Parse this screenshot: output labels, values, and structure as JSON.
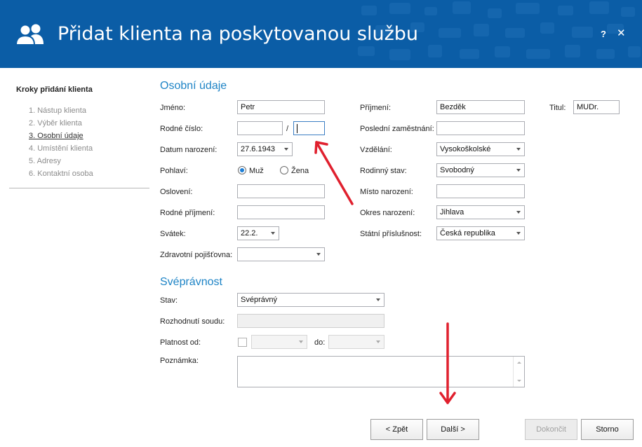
{
  "header": {
    "title": "Přidat klienta na poskytovanou službu",
    "help_label": "?",
    "close_label": "✕",
    "icon": "users-icon",
    "background_color": "#0b5da6"
  },
  "sidebar": {
    "title": "Kroky přidání klienta",
    "steps": [
      {
        "label": "1. Nástup klienta",
        "active": false
      },
      {
        "label": "2. Výběr klienta",
        "active": false
      },
      {
        "label": "3. Osobní údaje",
        "active": true
      },
      {
        "label": "4. Umístění klienta",
        "active": false
      },
      {
        "label": "5. Adresy",
        "active": false
      },
      {
        "label": "6. Kontaktní osoba",
        "active": false
      }
    ]
  },
  "personal": {
    "heading": "Osobní údaje",
    "jmeno": {
      "label": "Jméno:",
      "value": "Petr"
    },
    "prijmeni": {
      "label": "Příjmení:",
      "value": "Bezděk"
    },
    "titul": {
      "label": "Titul:",
      "value": "MUDr."
    },
    "rodne_cislo": {
      "label": "Rodné číslo:",
      "value_part1": "",
      "separator": "/",
      "value_part2": ""
    },
    "posledni_zamestnani": {
      "label": "Poslední zaměstnání:",
      "value": ""
    },
    "datum_narozeni": {
      "label": "Datum narození:",
      "value": "27.6.1943"
    },
    "vzdelani": {
      "label": "Vzdělání:",
      "value": "Vysokoškolské"
    },
    "pohlavi": {
      "label": "Pohlaví:",
      "options": [
        "Muž",
        "Žena"
      ],
      "selected": "Muž"
    },
    "rodinny_stav": {
      "label": "Rodinný stav:",
      "value": "Svobodný"
    },
    "osloveni": {
      "label": "Oslovení:",
      "value": ""
    },
    "misto_narozeni": {
      "label": "Místo narození:",
      "value": ""
    },
    "rodne_prijmeni": {
      "label": "Rodné příjmení:",
      "value": ""
    },
    "okres_narozeni": {
      "label": "Okres narození:",
      "value": "Jihlava"
    },
    "svatek": {
      "label": "Svátek:",
      "value": "22.2."
    },
    "statni_prislusnost": {
      "label": "Státní příslušnost:",
      "value": "Česká republika"
    },
    "zdravotni_pojistovna": {
      "label": "Zdravotní pojišťovna:",
      "value": ""
    }
  },
  "legal_capacity": {
    "heading": "Svéprávnost",
    "stav": {
      "label": "Stav:",
      "value": "Svéprávný"
    },
    "rozhodnuti_soudu": {
      "label": "Rozhodnutí soudu:",
      "value": ""
    },
    "platnost_od": {
      "label": "Platnost od:",
      "from": "",
      "to_label": "do:",
      "to": ""
    },
    "poznamka": {
      "label": "Poznámka:",
      "value": ""
    }
  },
  "footer": {
    "back": "< Zpět",
    "next": "Další >",
    "finish": "Dokončit",
    "cancel": "Storno"
  },
  "annotation_color": "#e0202e"
}
